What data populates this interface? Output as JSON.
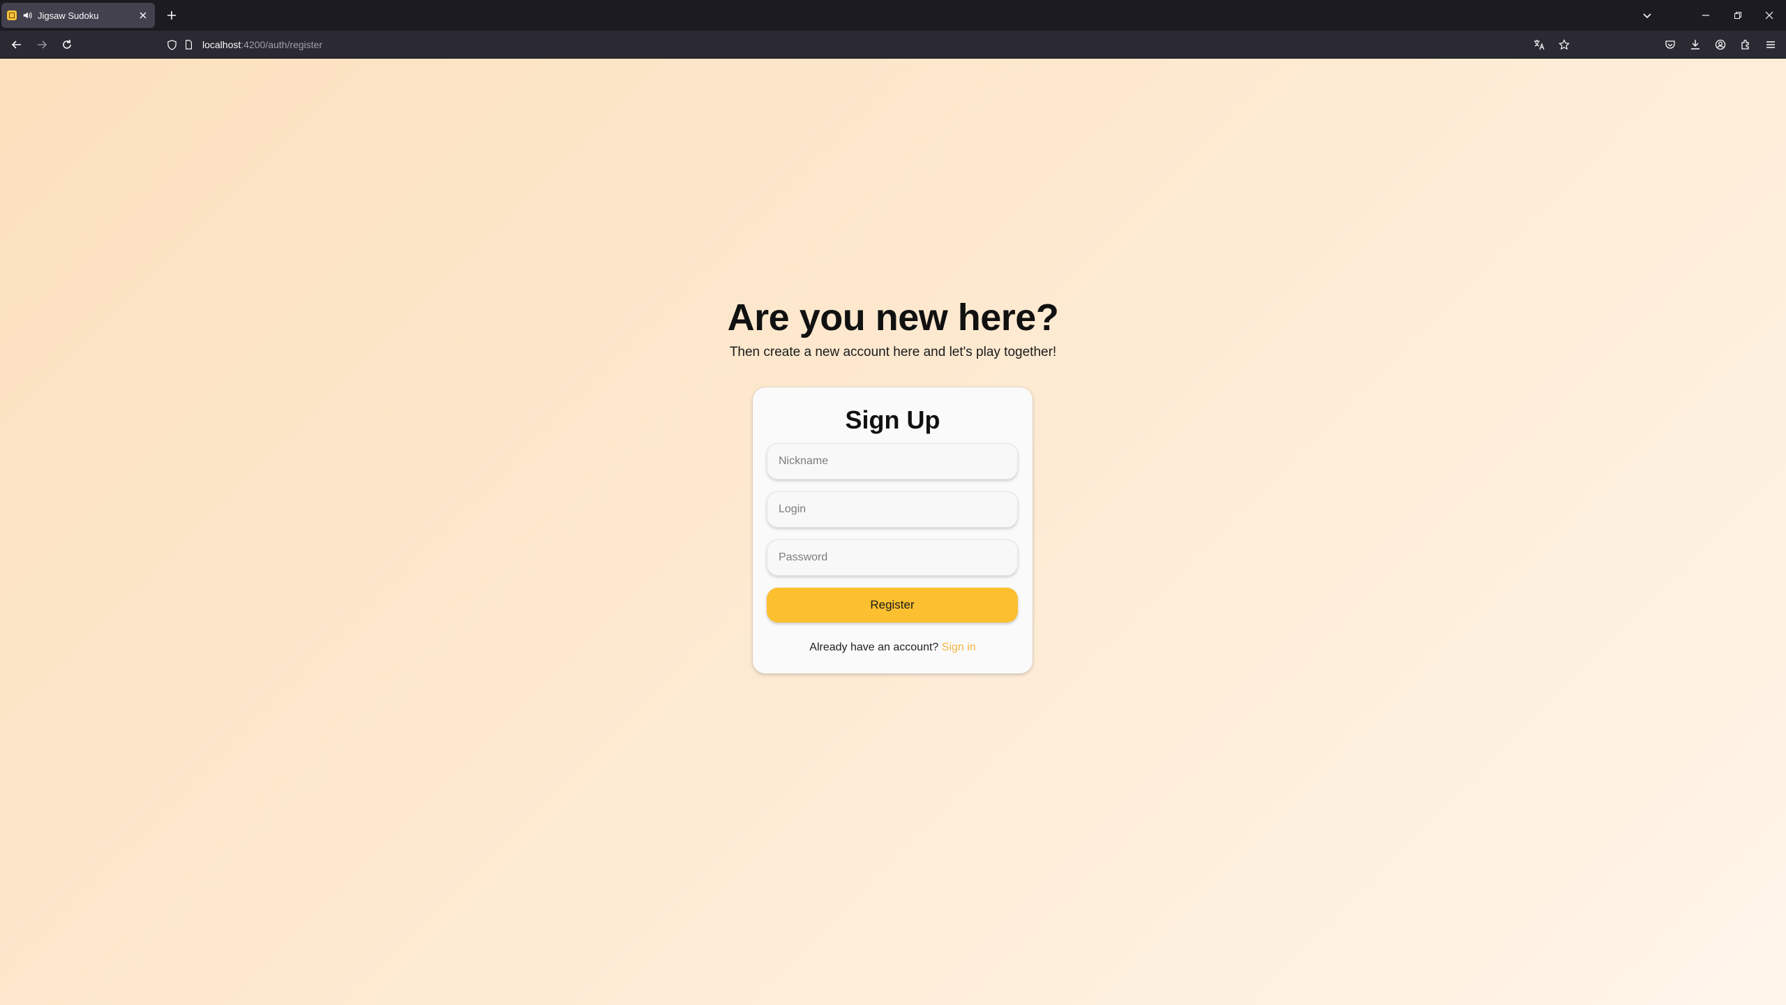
{
  "browser": {
    "tab": {
      "title": "Jigsaw Sudoku"
    },
    "url": {
      "host": "localhost",
      "path": ":4200/auth/register"
    }
  },
  "page": {
    "heading": "Are you new here?",
    "subheading": "Then create a new account here and let's play together!"
  },
  "form": {
    "title": "Sign Up",
    "nickname_placeholder": "Nickname",
    "login_placeholder": "Login",
    "password_placeholder": "Password",
    "register_label": "Register",
    "signin_prompt": "Already have an account?",
    "signin_link": "Sign in"
  },
  "colors": {
    "accent": "#fbbf2f",
    "link": "#f5b445",
    "background_start": "#fbe0bd",
    "background_end": "#fff5e9"
  },
  "icons": {
    "tab": [
      "favicon-icon",
      "speaker-icon",
      "close-icon"
    ],
    "navigation": [
      "back-arrow-icon",
      "forward-arrow-icon",
      "reload-icon"
    ],
    "url": [
      "shield-icon",
      "page-icon",
      "translate-icon",
      "star-icon"
    ],
    "toolbar": [
      "pocket-icon",
      "download-icon",
      "account-icon",
      "extensions-icon",
      "menu-icon"
    ],
    "window": [
      "list-all-tabs-icon",
      "minimize-icon",
      "restore-icon",
      "window-close-icon"
    ]
  }
}
